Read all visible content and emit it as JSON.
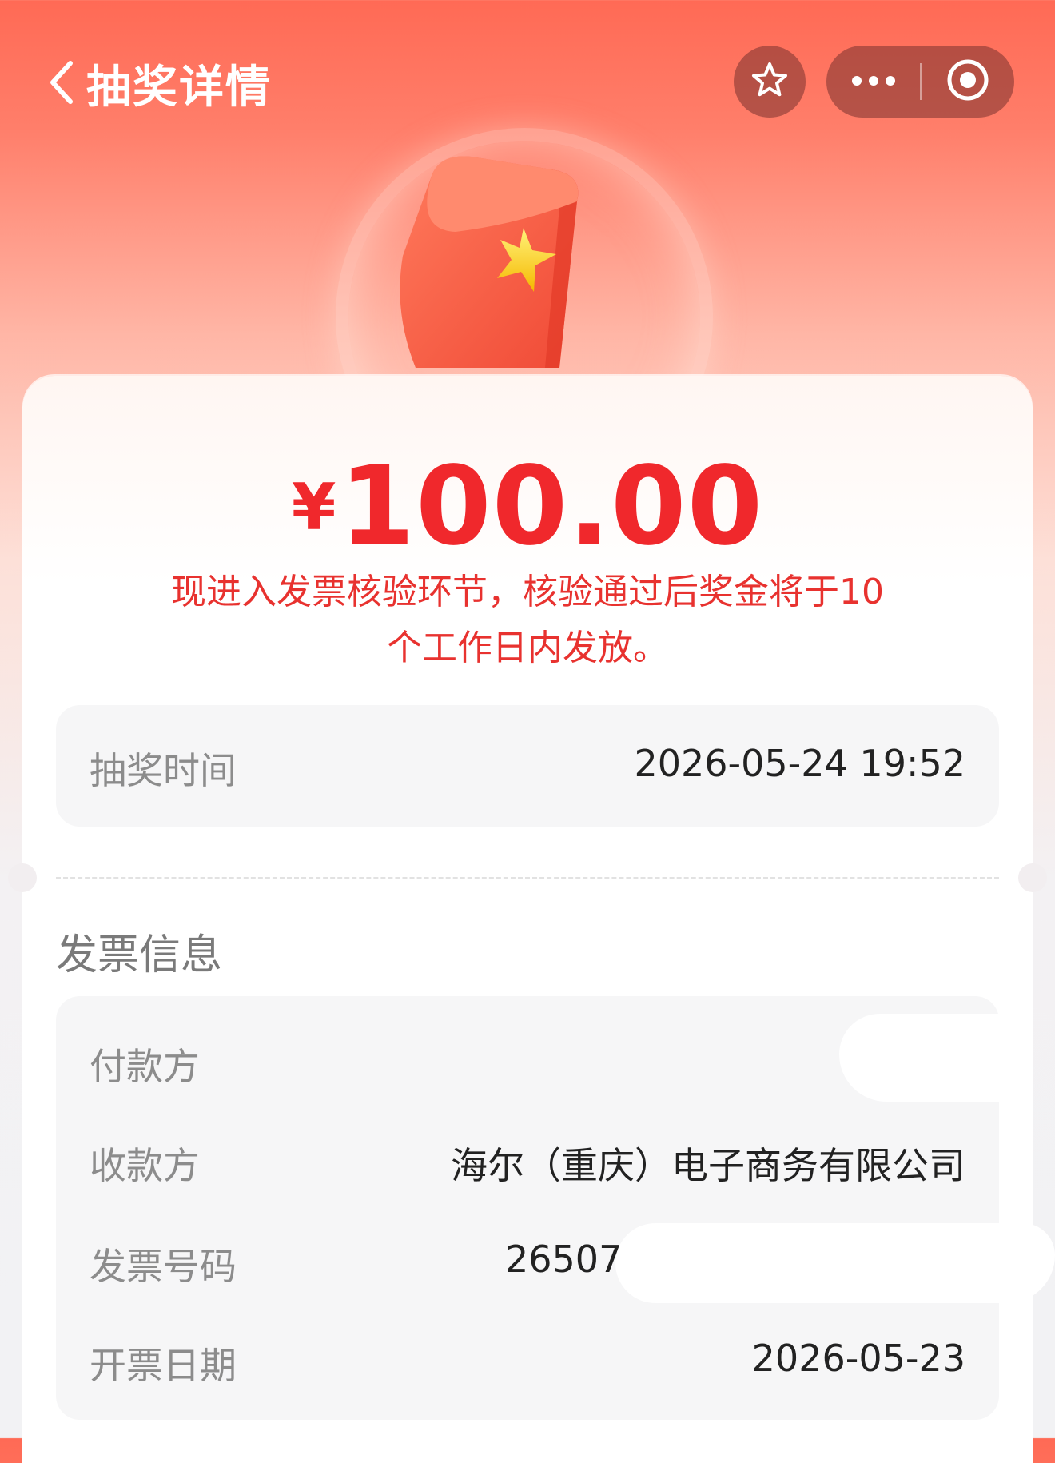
{
  "header": {
    "title": "抽奖详情",
    "back_icon": "chevron-left-icon",
    "favorite_icon": "star-outline-icon",
    "more_icon": "more-dots-icon",
    "close_icon": "target-circle-icon"
  },
  "prize": {
    "currency": "¥",
    "amount": "100.00",
    "notice_line1": "现进入发票核验环节，核验通过后奖金将于10",
    "notice_line2": "个工作日内发放。"
  },
  "draw_time": {
    "label": "抽奖时间",
    "value": "2026-05-24 19:52"
  },
  "invoice": {
    "section_title": "发票信息",
    "payer_label": "付款方",
    "payee_label": "收款方",
    "payee_value": "海尔（重庆）电子商务有限公司",
    "invoice_no_label": "发票号码",
    "invoice_no_value": "26507(",
    "issue_date_label": "开票日期",
    "issue_date_value": "2026-05-23"
  },
  "colors": {
    "accent_red": "#f0282c",
    "header_gradient_top": "#ff6a55"
  }
}
